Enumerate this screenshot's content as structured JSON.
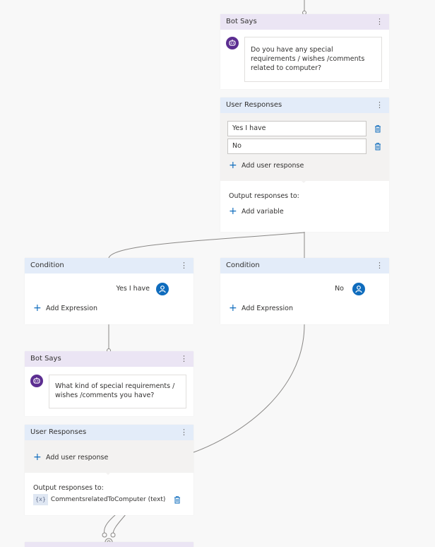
{
  "colors": {
    "bot_header": "#ebe5f4",
    "user_header": "#e3ecf9",
    "accent_blue": "#0f6cbd",
    "bot_purple": "#5c2e91"
  },
  "bot_says_1": {
    "title": "Bot Says",
    "more": "⋮",
    "message": "Do you have any special requirements / wishes /comments related to computer?"
  },
  "user_responses_1": {
    "title": "User Responses",
    "more": "⋮",
    "responses": [
      "Yes I have",
      "No"
    ],
    "add_response": "Add user response",
    "output_label": "Output responses to:",
    "add_variable": "Add variable"
  },
  "condition_left": {
    "title": "Condition",
    "more": "⋮",
    "value": "Yes I have",
    "add_expression": "Add Expression"
  },
  "condition_right": {
    "title": "Condition",
    "more": "⋮",
    "value": "No",
    "add_expression": "Add Expression"
  },
  "bot_says_2": {
    "title": "Bot Says",
    "more": "⋮",
    "message": "What kind of  special requirements / wishes /comments you have?"
  },
  "user_responses_2": {
    "title": "User Responses",
    "more": "⋮",
    "add_response": "Add user response",
    "output_label": "Output responses to:",
    "variable_icon": "{x}",
    "variable": "CommentsrelatedToComputer (text)"
  },
  "icons": [
    "bot-icon",
    "user-icon",
    "trash-icon",
    "plus-icon",
    "more-icon",
    "variable-icon"
  ]
}
